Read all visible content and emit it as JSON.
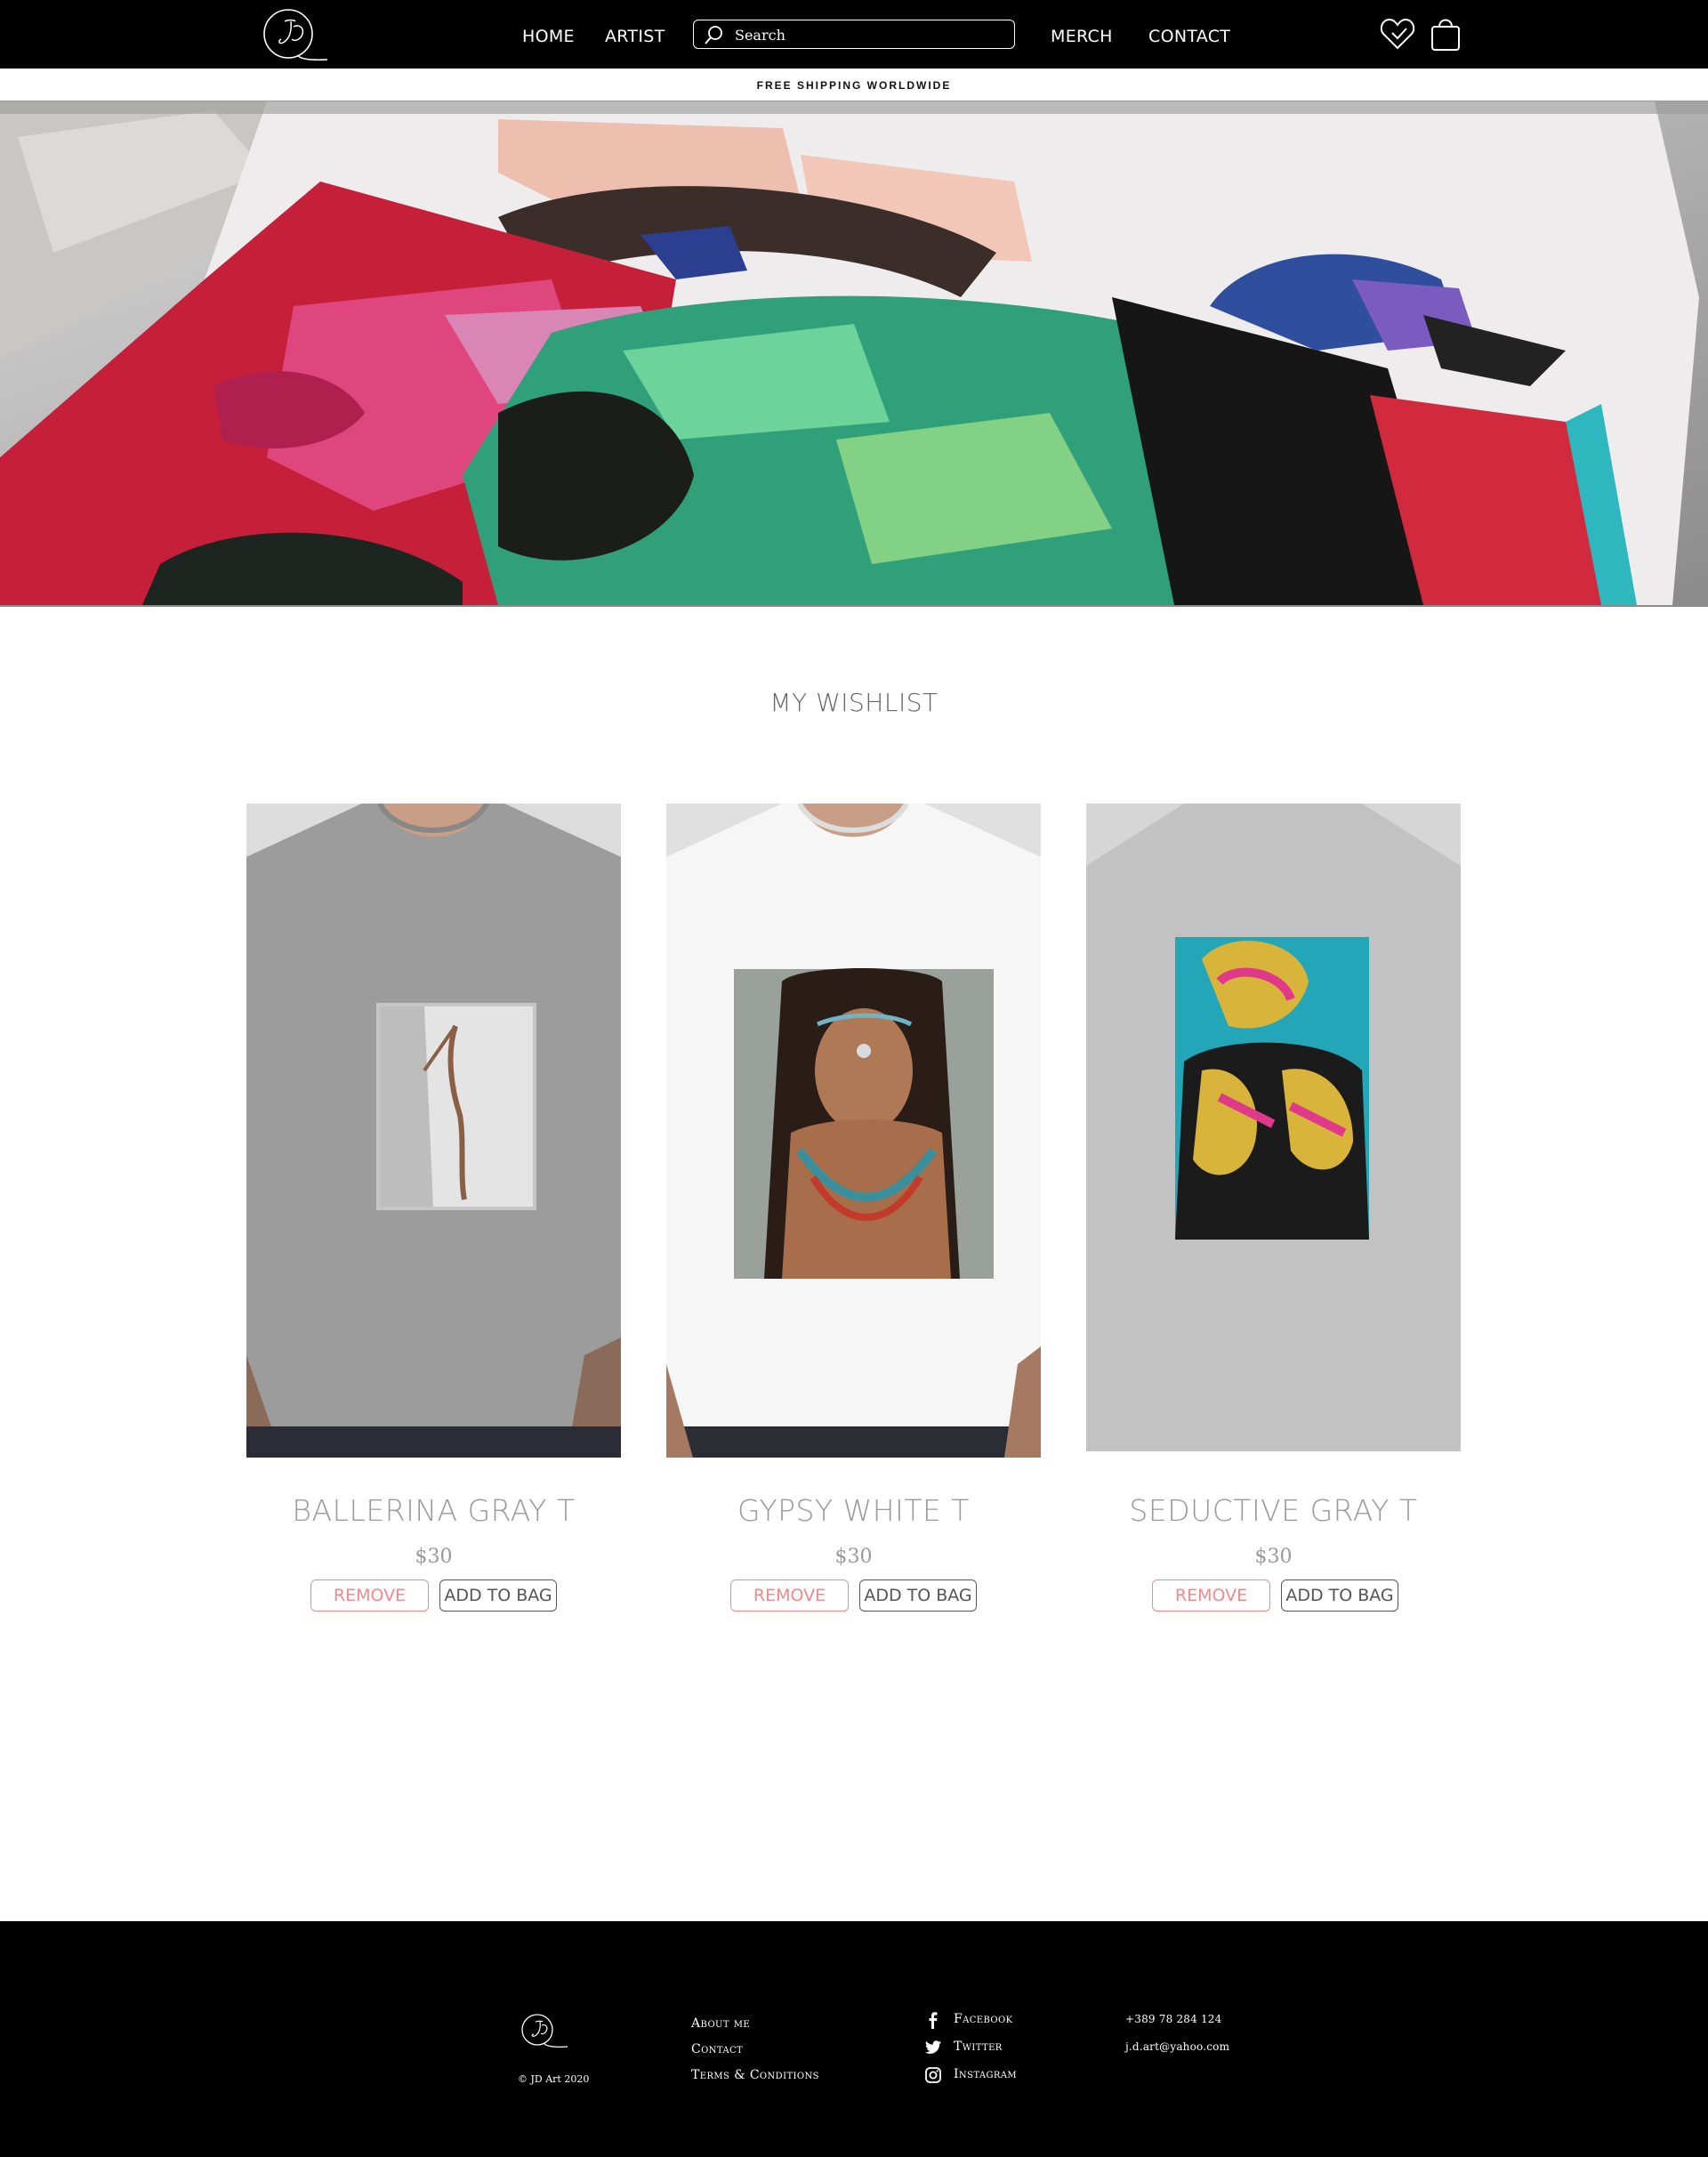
{
  "header": {
    "logo_alt": "JD",
    "nav": {
      "home": "HOME",
      "artist": "ARTIST",
      "merch": "MERCH",
      "contact": "CONTACT"
    },
    "search": {
      "placeholder": "Search",
      "value": ""
    },
    "icons": [
      "heart-icon",
      "bag-icon",
      "search-icon"
    ]
  },
  "shipping_banner": "FREE SHIPPING WORLDWIDE",
  "wishlist": {
    "title": "MY WISHLIST",
    "items": [
      {
        "name": "BALLERINA GRAY T",
        "price": "$30",
        "remove_label": "REMOVE",
        "add_label": "ADD TO BAG"
      },
      {
        "name": "GYPSY WHITE T",
        "price": "$30",
        "remove_label": "REMOVE",
        "add_label": "ADD TO BAG"
      },
      {
        "name": "SEDUCTIVE GRAY T",
        "price": "$30",
        "remove_label": "REMOVE",
        "add_label": "ADD TO BAG"
      }
    ]
  },
  "footer": {
    "copyright": "© JD Art 2020",
    "links": {
      "about": "About me",
      "contact": "Contact",
      "terms": "Terms & Conditions"
    },
    "social": {
      "facebook": "Facebook",
      "twitter": "Twitter",
      "instagram": "Instagram"
    },
    "phone": "+389 78 284 124",
    "email": "j.d.art@yahoo.com"
  },
  "colors": {
    "header_bg": "#000000",
    "remove_accent": "#f08a8a",
    "button_border": "#555555",
    "muted_text": "#999999"
  }
}
